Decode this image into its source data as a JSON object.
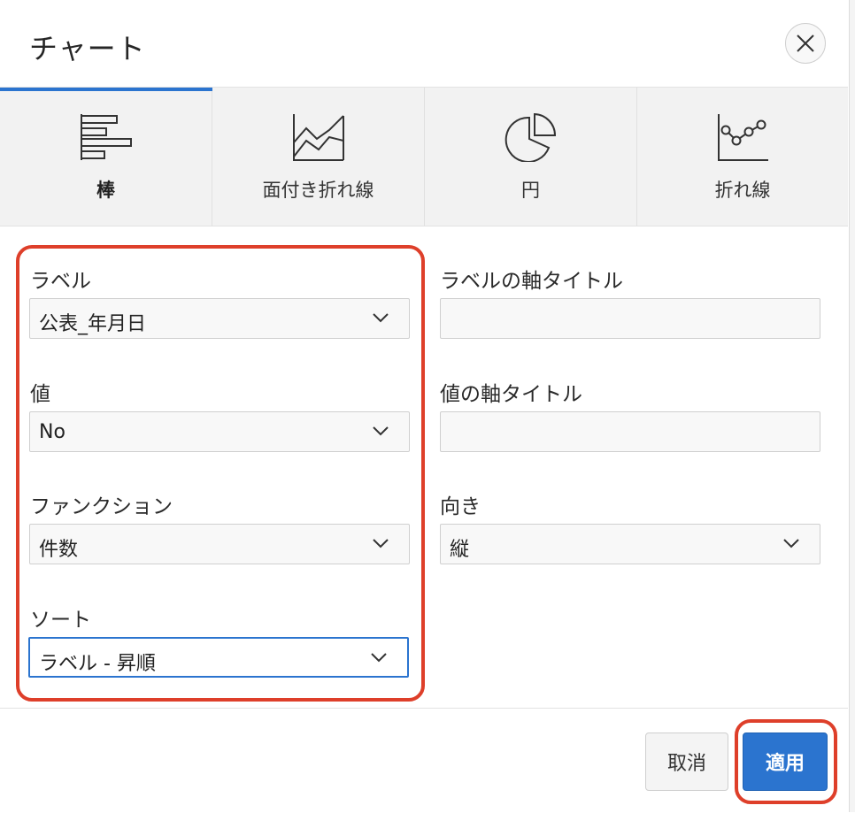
{
  "dialog": {
    "title": "チャート",
    "close_icon": "close-icon"
  },
  "tabs": [
    {
      "label": "棒",
      "icon": "bar-chart-icon",
      "active": true
    },
    {
      "label": "面付き折れ線",
      "icon": "area-chart-icon",
      "active": false
    },
    {
      "label": "円",
      "icon": "pie-chart-icon",
      "active": false
    },
    {
      "label": "折れ線",
      "icon": "line-chart-icon",
      "active": false
    }
  ],
  "form": {
    "label": {
      "label": "ラベル",
      "value": "公表_年月日"
    },
    "value": {
      "label": "値",
      "value": "No"
    },
    "function": {
      "label": "ファンクション",
      "value": "件数"
    },
    "sort": {
      "label": "ソート",
      "value": "ラベル - 昇順"
    },
    "label_axis_title": {
      "label": "ラベルの軸タイトル",
      "value": ""
    },
    "value_axis_title": {
      "label": "値の軸タイトル",
      "value": ""
    },
    "orientation": {
      "label": "向き",
      "value": "縦"
    }
  },
  "footer": {
    "cancel_label": "取消",
    "apply_label": "適用"
  },
  "colors": {
    "accent": "#2b74cf",
    "highlight": "#de3f2a"
  }
}
